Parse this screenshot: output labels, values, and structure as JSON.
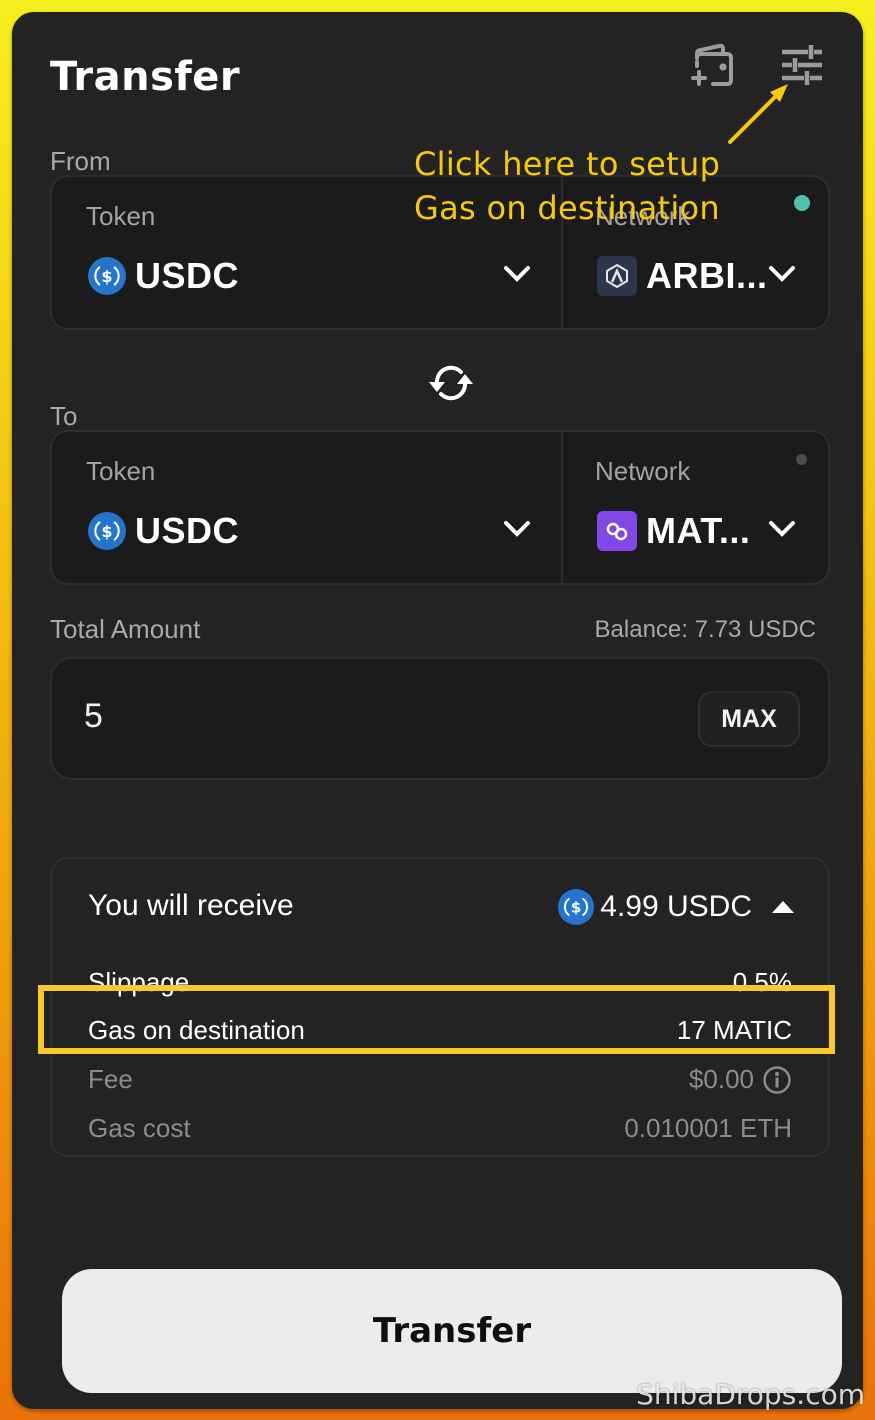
{
  "header": {
    "title": "Transfer",
    "icons": [
      "wallet-add-icon",
      "settings-sliders-icon"
    ]
  },
  "annotation": {
    "line1": "Click here to setup",
    "line2": "Gas on destination",
    "color": "#f6c90e"
  },
  "from": {
    "label": "From",
    "token_label": "Token",
    "token_value": "USDC",
    "network_label": "Network",
    "network_value": "ARBI...",
    "status": "active",
    "status_color": "#4ec2ae"
  },
  "swap": {
    "icon": "swap-arrows-icon"
  },
  "to": {
    "label": "To",
    "token_label": "Token",
    "token_value": "USDC",
    "network_label": "Network",
    "network_value": "MAT...",
    "status": "idle"
  },
  "amount": {
    "label": "Total Amount",
    "balance": "Balance: 7.73 USDC",
    "value": "5",
    "max_label": "MAX"
  },
  "receive": {
    "title": "You will receive",
    "amount": "4.99 USDC",
    "rows": [
      {
        "label": "Slippage",
        "value": "0.5%"
      },
      {
        "label": "Gas on destination",
        "value": "17 MATIC"
      },
      {
        "label": "Fee",
        "value": "$0.00"
      },
      {
        "label": "Gas cost",
        "value": "0.010001 ETH"
      }
    ]
  },
  "actions": {
    "transfer_label": "Transfer"
  },
  "watermark": "ShibaDrops.com",
  "colors": {
    "card": "#232323",
    "panel": "#1b1b1b",
    "usdc": "#2775ca",
    "matic": "#8247e5",
    "arbitrum_bg": "#2c374b",
    "highlight": "#f7c92f",
    "button": "#ececec"
  }
}
